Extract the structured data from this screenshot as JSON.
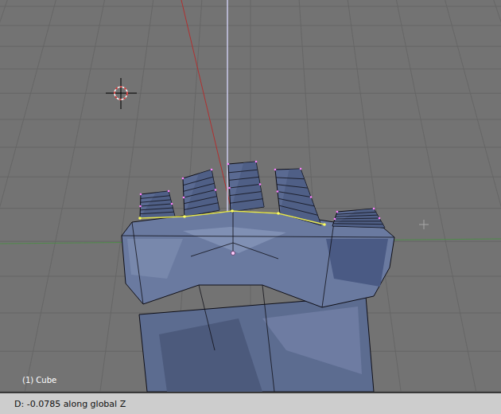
{
  "viewport": {
    "object_label": "(1) Cube"
  },
  "status_bar": {
    "text": "D: -0.0785 along global Z"
  }
}
